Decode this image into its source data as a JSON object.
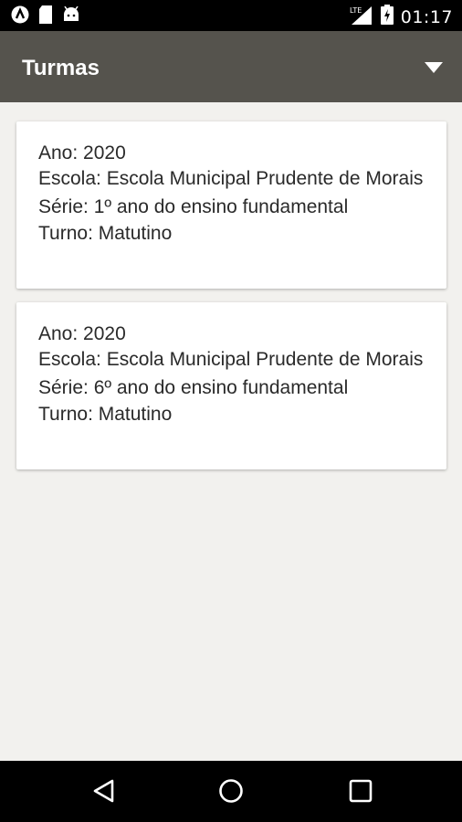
{
  "status_bar": {
    "time": "01:17",
    "network": "LTE",
    "icons": [
      "app-icon",
      "sd-card-icon",
      "android-icon",
      "signal-icon",
      "battery-charging-icon"
    ]
  },
  "app_bar": {
    "title": "Turmas",
    "menu_icon": "dropdown-caret-icon"
  },
  "cards": [
    {
      "ano": "Ano: 2020",
      "escola": "Escola: Escola Municipal Prudente de Morais",
      "serie": "Série: 1º ano do ensino fundamental",
      "turno": "Turno: Matutino"
    },
    {
      "ano": "Ano: 2020",
      "escola": "Escola: Escola Municipal Prudente de Morais",
      "serie": "Série: 6º ano do ensino fundamental",
      "turno": "Turno: Matutino"
    }
  ],
  "nav_bar": {
    "icons": [
      "back-icon",
      "home-icon",
      "recents-icon"
    ]
  },
  "colors": {
    "app_bar": "#55534d",
    "background": "#f2f1ee",
    "card": "#ffffff",
    "text": "#2a2a2a"
  }
}
